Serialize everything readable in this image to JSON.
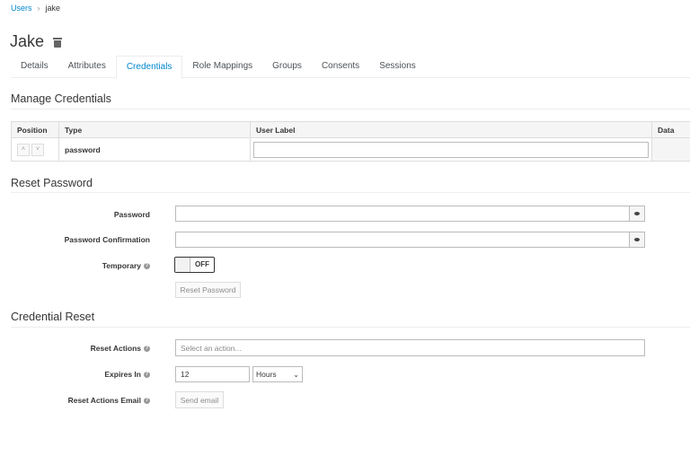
{
  "breadcrumb": {
    "parent": "Users",
    "current": "jake"
  },
  "title": "Jake",
  "tabs": [
    {
      "label": "Details"
    },
    {
      "label": "Attributes"
    },
    {
      "label": "Credentials"
    },
    {
      "label": "Role Mappings"
    },
    {
      "label": "Groups"
    },
    {
      "label": "Consents"
    },
    {
      "label": "Sessions"
    }
  ],
  "manage": {
    "heading": "Manage Credentials",
    "columns": [
      "Position",
      "Type",
      "User Label",
      "Data"
    ],
    "rows": [
      {
        "type": "password",
        "user_label": ""
      }
    ],
    "up": "˄",
    "down": "˅"
  },
  "reset_password": {
    "heading": "Reset Password",
    "password_label": "Password",
    "confirm_label": "Password Confirmation",
    "temporary_label": "Temporary",
    "temporary_state": "OFF",
    "button": "Reset Password"
  },
  "credential_reset": {
    "heading": "Credential Reset",
    "actions_label": "Reset Actions",
    "actions_placeholder": "Select an action...",
    "expires_label": "Expires In",
    "expires_value": "12",
    "expires_unit": "Hours",
    "email_label": "Reset Actions Email",
    "email_button": "Send email"
  },
  "help_glyph": "?"
}
